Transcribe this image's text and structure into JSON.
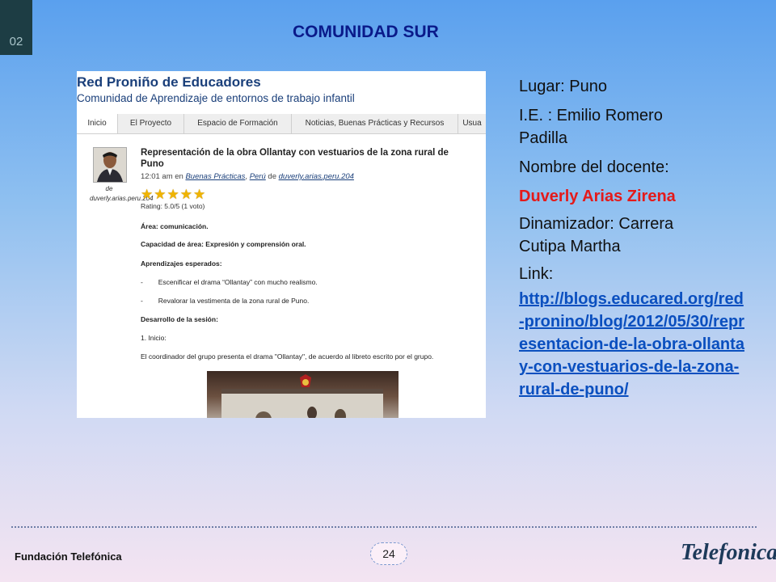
{
  "slide": {
    "number": "02",
    "title": "COMUNIDAD SUR",
    "page": "24",
    "footer_org": "Fundación Telefónica",
    "logo_text": "Telefonica"
  },
  "blog": {
    "name": "Red Proniño de Educadores",
    "subtitle": "Comunidad de Aprendizaje de entornos de trabajo infantil",
    "tabs": [
      "Inicio",
      "El Proyecto",
      "Espacio de Formación",
      "Noticias, Buenas Prácticas y Recursos",
      "Usua"
    ],
    "author_caption": "de duverly.arias.peru.204",
    "post": {
      "title": "Representación de la obra Ollantay con vestuarios de la zona rural de Puno",
      "meta_time": "12:01 am en",
      "meta_cat1": "Buenas Prácticas",
      "meta_cat2": "Perú",
      "meta_by": "de",
      "meta_author": "duverly.arias.peru.204",
      "rating": "Rating: 5.0/5 (1 voto)",
      "rating_value": 5,
      "lines": [
        "Área: comunicación.",
        "Capacidad de área: Expresión y comprensión oral.",
        "Aprendizajes esperados:",
        "-        Escenificar el drama “Ollantay” con mucho realismo.",
        "-        Revalorar la vestimenta de la zona rural de Puno.",
        "Desarrollo de la sesión:",
        "1. Inicio:",
        "El coordinador del grupo presenta el drama \"Ollantay\", de acuerdo al libreto escrito por el grupo."
      ]
    }
  },
  "info": {
    "lugar": "Lugar: Puno",
    "ie_line1": "I.E. : Emilio Romero",
    "ie_line2": "Padilla",
    "docente_label": "Nombre del docente:",
    "docente_name": "Duverly Arias Zirena",
    "dinamizador_line1": "Dinamizador:  Carrera",
    "dinamizador_line2": "Cutipa Martha",
    "link_label": "Link:",
    "link_url": "http://blogs.educared.org/red-pronino/blog/2012/05/30/representacion-de-la-obra-ollantay-con-vestuarios-de-la-zona-rural-de-puno/"
  },
  "colors": {
    "title": "#0a1a8a",
    "docente_name": "#e41a1a",
    "link": "#0a4fbf"
  }
}
